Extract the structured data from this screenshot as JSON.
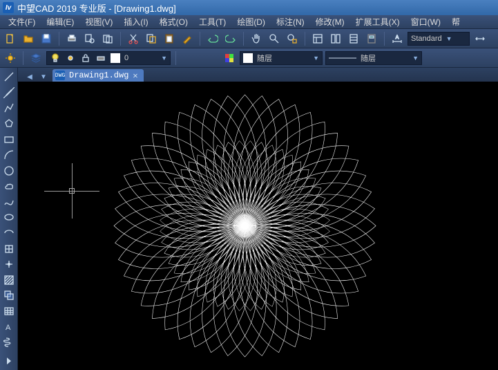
{
  "titlebar": {
    "app_logo": "Iv",
    "title": "中望CAD 2019 专业版 - [Drawing1.dwg]"
  },
  "menus": [
    {
      "label": "文件(F)"
    },
    {
      "label": "编辑(E)"
    },
    {
      "label": "视图(V)"
    },
    {
      "label": "插入(I)"
    },
    {
      "label": "格式(O)"
    },
    {
      "label": "工具(T)"
    },
    {
      "label": "绘图(D)"
    },
    {
      "label": "标注(N)"
    },
    {
      "label": "修改(M)"
    },
    {
      "label": "扩展工具(X)"
    },
    {
      "label": "窗口(W)"
    },
    {
      "label": "帮"
    }
  ],
  "toolbar1": {
    "new_label": "New",
    "open_label": "Open",
    "save_label": "Save",
    "undo": "Undo",
    "redo": "Redo",
    "style_selector": "Standard"
  },
  "toolbar2": {
    "layer_value": "0",
    "layer_dd_label": "随层",
    "layer_dd_label2": "随层"
  },
  "doc_tab": {
    "filename": "Drawing1.dwg"
  },
  "left_tools": [
    "line",
    "polyline",
    "polygon",
    "rectangle",
    "arc",
    "circle",
    "revision-cloud",
    "spline",
    "ellipse",
    "ellipse-arc",
    "block",
    "point",
    "hatch",
    "region",
    "table",
    "text",
    "helix"
  ]
}
